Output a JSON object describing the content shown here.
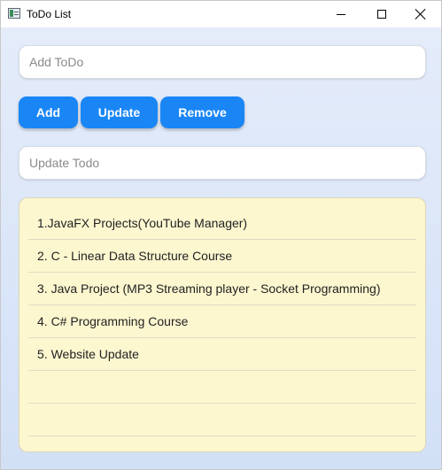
{
  "window": {
    "title": "ToDo List"
  },
  "add_input": {
    "placeholder": "Add ToDo",
    "value": ""
  },
  "buttons": {
    "add": "Add",
    "update": "Update",
    "remove": "Remove"
  },
  "update_input": {
    "placeholder": "Update Todo",
    "value": ""
  },
  "todo_list": {
    "items": [
      "1.JavaFX Projects(YouTube Manager)",
      "2. C - Linear Data Structure Course",
      "3. Java Project (MP3 Streaming player - Socket Programming)",
      "4. C# Programming Course",
      "5. Website Update",
      "",
      ""
    ]
  },
  "colors": {
    "button": "#1a86f5",
    "list_background": "#fdf7d0",
    "background_top": "#e4ecfa",
    "background_bottom": "#d2e0f6"
  }
}
